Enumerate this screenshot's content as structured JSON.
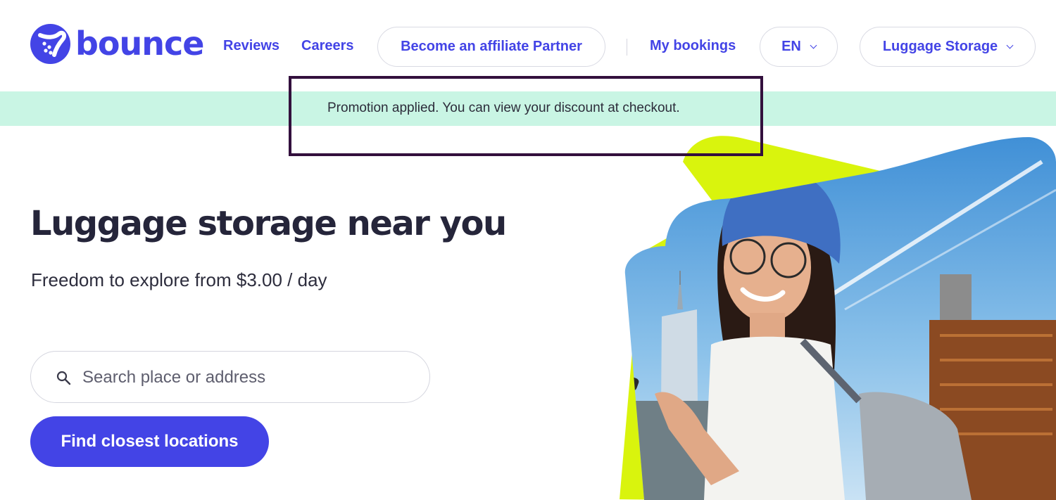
{
  "header": {
    "logo_text": "bounce",
    "nav": {
      "reviews": "Reviews",
      "careers": "Careers",
      "affiliate": "Become an affiliate Partner",
      "bookings": "My bookings",
      "language": "EN",
      "storage_menu": "Luggage Storage"
    }
  },
  "promo": {
    "message": "Promotion applied. You can view your discount at checkout."
  },
  "hero": {
    "title": "Luggage storage near you",
    "subtitle": "Freedom to explore from $3.00 / day",
    "search_placeholder": "Search place or address",
    "search_value": "",
    "cta_label": "Find closest locations"
  },
  "icons": {
    "logo": "bounce-logo-icon",
    "search": "search-icon",
    "chevron": "chevron-down-icon"
  },
  "colors": {
    "brand": "#4344e6",
    "promo_bg": "#c9f5e4",
    "highlight_border": "#33103d",
    "accent_lime": "#d9f40d",
    "text_dark": "#25253a"
  }
}
